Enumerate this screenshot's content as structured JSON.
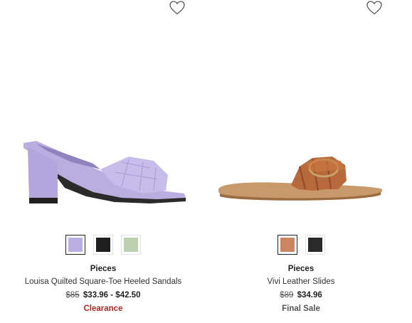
{
  "products": [
    {
      "brand": "Pieces",
      "name": "Louisa Quilted Square-Toe Heeled Sandals",
      "original_price": "$85",
      "sale_price": "$33.96 - $42.50",
      "tag": "Clearance",
      "tag_color": "#b3261e",
      "swatches": [
        {
          "color": "#b9aee0",
          "selected": true
        },
        {
          "color": "#1e1e1e",
          "selected": false
        },
        {
          "color": "#bcd0ad",
          "selected": false
        }
      ],
      "image_icon": "lavender-heeled-mule-sandal"
    },
    {
      "brand": "Pieces",
      "name": "Vivi Leather Slides",
      "original_price": "$89",
      "sale_price": "$34.96",
      "tag": "Final Sale",
      "tag_color": "#555555",
      "swatches": [
        {
          "color": "#c98660",
          "selected": true
        },
        {
          "color": "#2a2a2a",
          "selected": false
        }
      ],
      "image_icon": "tan-leather-slide-sandal"
    }
  ],
  "icons": {
    "wishlist": "heart-outline-icon"
  }
}
